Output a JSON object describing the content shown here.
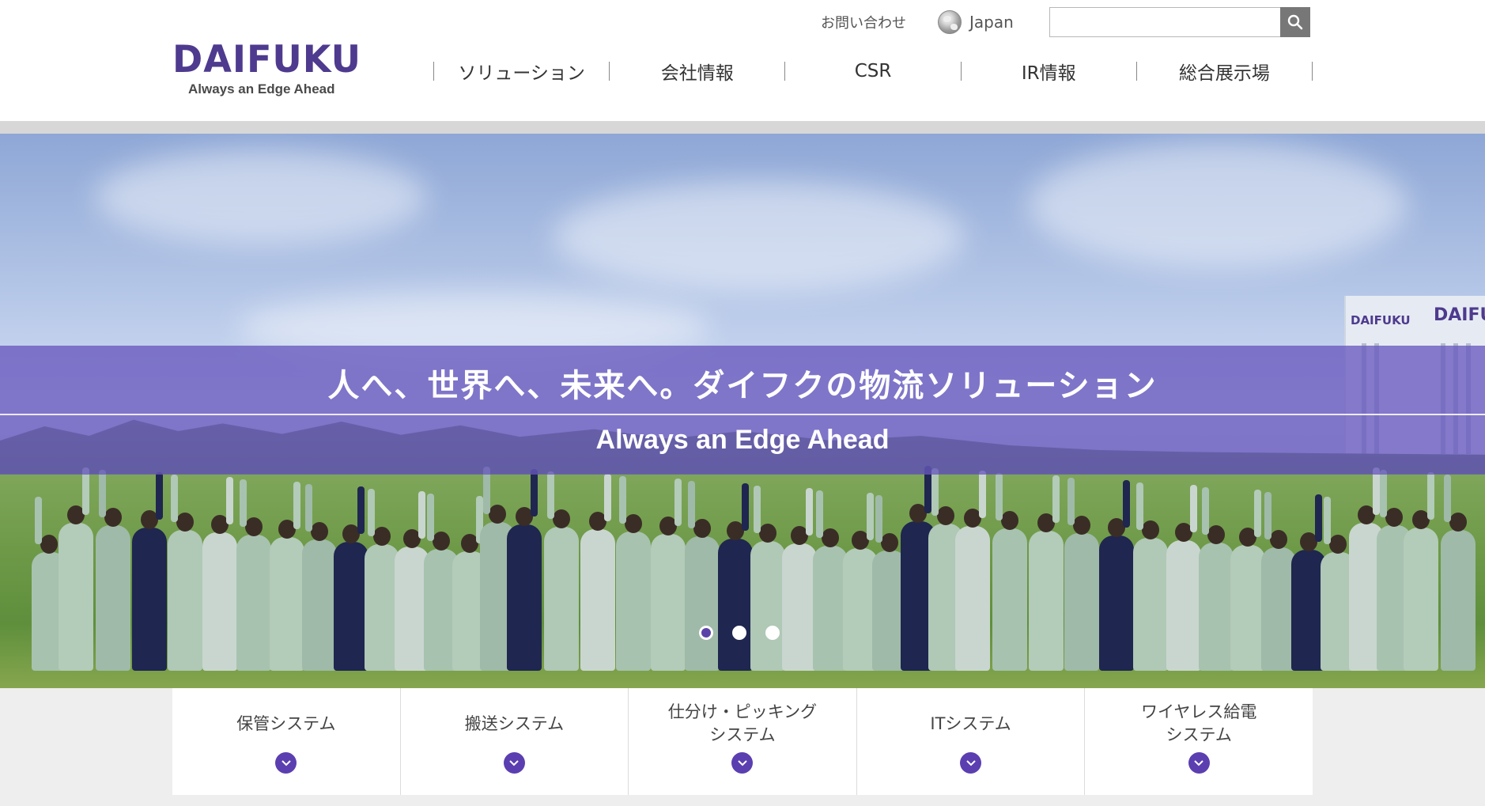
{
  "header": {
    "logo_word": "DAIFUKU",
    "logo_tagline": "Always an Edge Ahead",
    "contact_label": "お問い合わせ",
    "language_label": "Japan",
    "search": {
      "value": "",
      "placeholder": ""
    },
    "nav": [
      {
        "label": "ソリューション"
      },
      {
        "label": "会社情報"
      },
      {
        "label": "CSR"
      },
      {
        "label": "IR情報"
      },
      {
        "label": "総合展示場"
      }
    ]
  },
  "hero": {
    "title": "人へ、世界へ、未来へ。ダイフクの物流ソリューション",
    "subtitle": "Always an Edge Ahead",
    "building_sign_small": "DAIFUKU",
    "building_sign_large": "DAIFUI",
    "slides": {
      "count": 3,
      "active": 1
    }
  },
  "categories": [
    {
      "label": "保管システム"
    },
    {
      "label": "搬送システム"
    },
    {
      "label": "仕分け・ピッキング\nシステム"
    },
    {
      "label": "ITシステム"
    },
    {
      "label": "ワイヤレス給電\nシステム"
    }
  ],
  "colors": {
    "brand": "#4e3a8e",
    "overlay": "#6858be",
    "category_button": "#5b3fb0",
    "search_button": "#777777"
  },
  "icons": {
    "search": "search-icon",
    "globe": "globe-icon",
    "expand": "chevron-down-icon"
  }
}
